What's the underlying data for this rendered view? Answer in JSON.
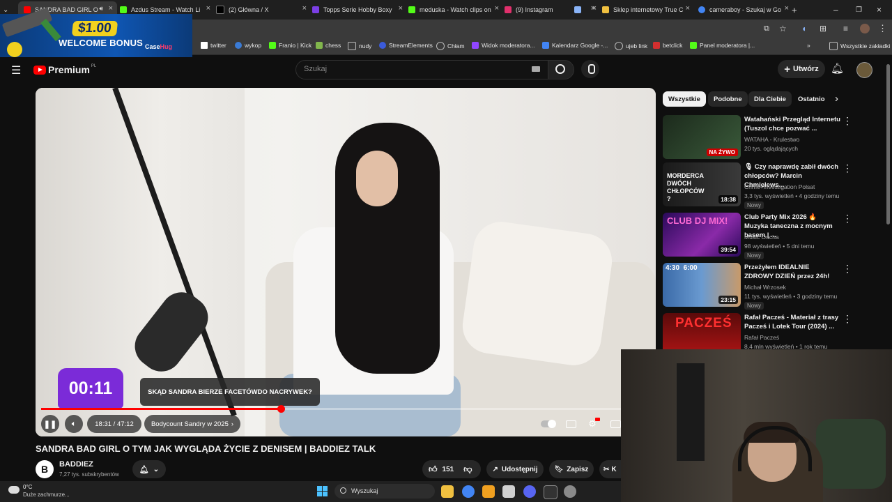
{
  "tabs": [
    {
      "title": "SANDRA BAD GIRL O",
      "color": "#ff0000",
      "active": true
    },
    {
      "title": "Azdus Stream - Watch Li",
      "color": "#53fc18"
    },
    {
      "title": "(2) Główna / X",
      "color": "#ffffff"
    },
    {
      "title": "Topps Serie Hobby Boxy",
      "color": "#7b3fe4"
    },
    {
      "title": "meduska - Watch clips on",
      "color": "#53fc18"
    },
    {
      "title": "(9) Instagram",
      "color": "#e1306c"
    },
    {
      "title": "",
      "color": "#8ab4f8"
    },
    {
      "title": "Sklep internetowy True C",
      "color": "#f0c040"
    },
    {
      "title": "cameraboy - Szukaj w Go",
      "color": "#4285f4"
    }
  ],
  "ad": {
    "price": "$1.00",
    "welcome": "WELCOME BONUS",
    "brand_a": "Case",
    "brand_b": "Hug"
  },
  "bookmarks": [
    {
      "label": "twitter",
      "color": "#ffffff"
    },
    {
      "label": "wykop",
      "color": "#3a7bd5"
    },
    {
      "label": "Franio | Kick",
      "color": "#53fc18"
    },
    {
      "label": "chess",
      "color": "#81b64c"
    },
    {
      "label": "nudy",
      "color": "#bbbbbb"
    },
    {
      "label": "StreamElements",
      "color": "#3b5bdb"
    },
    {
      "label": "Chłam",
      "color": "#bbbbbb"
    },
    {
      "label": "Widok moderatora...",
      "color": "#9146ff"
    },
    {
      "label": "Kalendarz Google -...",
      "color": "#4285f4"
    },
    {
      "label": "ujeb link",
      "color": "#bbbbbb"
    },
    {
      "label": "betclick",
      "color": "#d32f2f"
    },
    {
      "label": "Panel moderatora |...",
      "color": "#53fc18"
    }
  ],
  "all_bookmarks": "Wszystkie zakładki",
  "yt": {
    "logo": "Premium",
    "region": "PL",
    "search_placeholder": "Szukaj",
    "create": "Utwórz"
  },
  "player": {
    "timer": "00:11",
    "caption": "SKĄD SANDRA BIERZE FACETÓWDO NACRYWEK?",
    "time": "18:31 / 47:12",
    "chapter": "Bodycount Sandry w 2025",
    "progress": 0.39
  },
  "video": {
    "title": "SANDRA BAD GIRL O TYM JAK WYGLĄDA ŻYCIE Z DENISEM | BADDIEZ TALK",
    "channel": "BADDIEZ",
    "subs": "7,27 tys. subskrybentów",
    "likes": "151",
    "share": "Udostępnij",
    "save": "Zapisz",
    "clip": "K"
  },
  "chips": [
    "Wszystkie",
    "Podobne",
    "Dla Ciebie",
    "Ostatnio"
  ],
  "recs": [
    {
      "title": "Watahański Przegląd Internetu (Tuszol chce pozwać ...",
      "channel": "WATAHA - Krulestwo",
      "meta": "20 tys. oglądających",
      "badge": "",
      "dur": "",
      "live": "NA ŻYWO",
      "thumb": "#2f3a2a"
    },
    {
      "title": "🎙 Czy naprawdę zabił dwóch chłopców? Marcin Chmielews...",
      "channel": "Crime+Investigation Polsat",
      "meta": "3,3 tys. wyświetleń • 4 godziny temu",
      "badge": "Nowy",
      "dur": "18:38",
      "live": "",
      "thumb": "#2a2a2a",
      "thumb_text": "MORDERCA DWÓCH CHŁOPCÓW ?"
    },
    {
      "title": "Club Party Mix 2026 🔥 Muzyka taneczna z mocnym basem | ...",
      "channel": "Music Oncha",
      "meta": "98 wyświetleń • 5 dni temu",
      "badge": "Nowy",
      "dur": "39:54",
      "live": "",
      "thumb": "#4a1a7a",
      "thumb_text": "CLUB DJ MIX!"
    },
    {
      "title": "Przeżyłem IDEALNIE ZDROWY DZIEŃ przez 24h!",
      "channel": "Michał Wrzosek",
      "meta": "11 tys. wyświetleń • 3 godziny temu",
      "badge": "Nowy",
      "dur": "23:15",
      "live": "",
      "thumb": "#3a6aa8",
      "thumb_text": "4:30  6:00"
    },
    {
      "title": "Rafał Pacześ - Materiał z trasy Pacześ i Lotek Tour (2024) ...",
      "channel": "Rafał Pacześ",
      "meta": "8,4 mln wyświetleń • 1 rok temu",
      "badge": "",
      "dur": "",
      "live": "",
      "thumb": "#8a1010",
      "thumb_text": "PACZEŚ"
    }
  ],
  "taskbar": {
    "temp": "0°C",
    "weather": "Duże zachmurze...",
    "search": "Wyszukaj"
  }
}
